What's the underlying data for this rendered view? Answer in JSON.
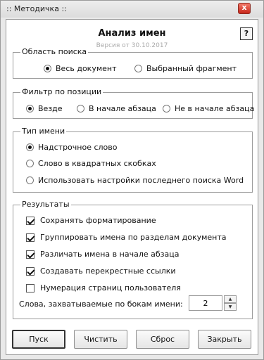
{
  "window": {
    "title": ":: Методичка ::",
    "close_label": "x"
  },
  "header": {
    "title": "Анализ имен",
    "version": "Версия от  30.10.2017",
    "help_label": "?"
  },
  "search_area": {
    "legend": "Область поиска",
    "options": [
      {
        "label": "Весь документ",
        "checked": true
      },
      {
        "label": "Выбранный фрагмент",
        "checked": false
      }
    ]
  },
  "position_filter": {
    "legend": "Фильтр по позиции",
    "options": [
      {
        "label": "Везде",
        "checked": true
      },
      {
        "label": "В начале абзаца",
        "checked": false
      },
      {
        "label": "Не в начале абзаца",
        "checked": false
      }
    ]
  },
  "name_type": {
    "legend": "Тип имени",
    "options": [
      {
        "label": "Надстрочное слово",
        "checked": true
      },
      {
        "label": "Слово в квадратных скобках",
        "checked": false
      },
      {
        "label": "Использовать настройки последнего поиска Word",
        "checked": false
      }
    ]
  },
  "results": {
    "legend": "Результаты",
    "checkboxes": [
      {
        "label": "Сохранять форматирование",
        "checked": true
      },
      {
        "label": "Группировать имена по разделам документа",
        "checked": true
      },
      {
        "label": "Различать имена в начале абзаца",
        "checked": true
      },
      {
        "label": "Создавать перекрестные ссылки",
        "checked": true
      },
      {
        "label": "Нумерация страниц пользователя",
        "checked": false
      }
    ],
    "words_label": "Слова, захватываемые по бокам имени:",
    "words_value": "2"
  },
  "buttons": {
    "run": "Пуск",
    "clear": "Чистить",
    "reset": "Сброс",
    "close": "Закрыть"
  }
}
